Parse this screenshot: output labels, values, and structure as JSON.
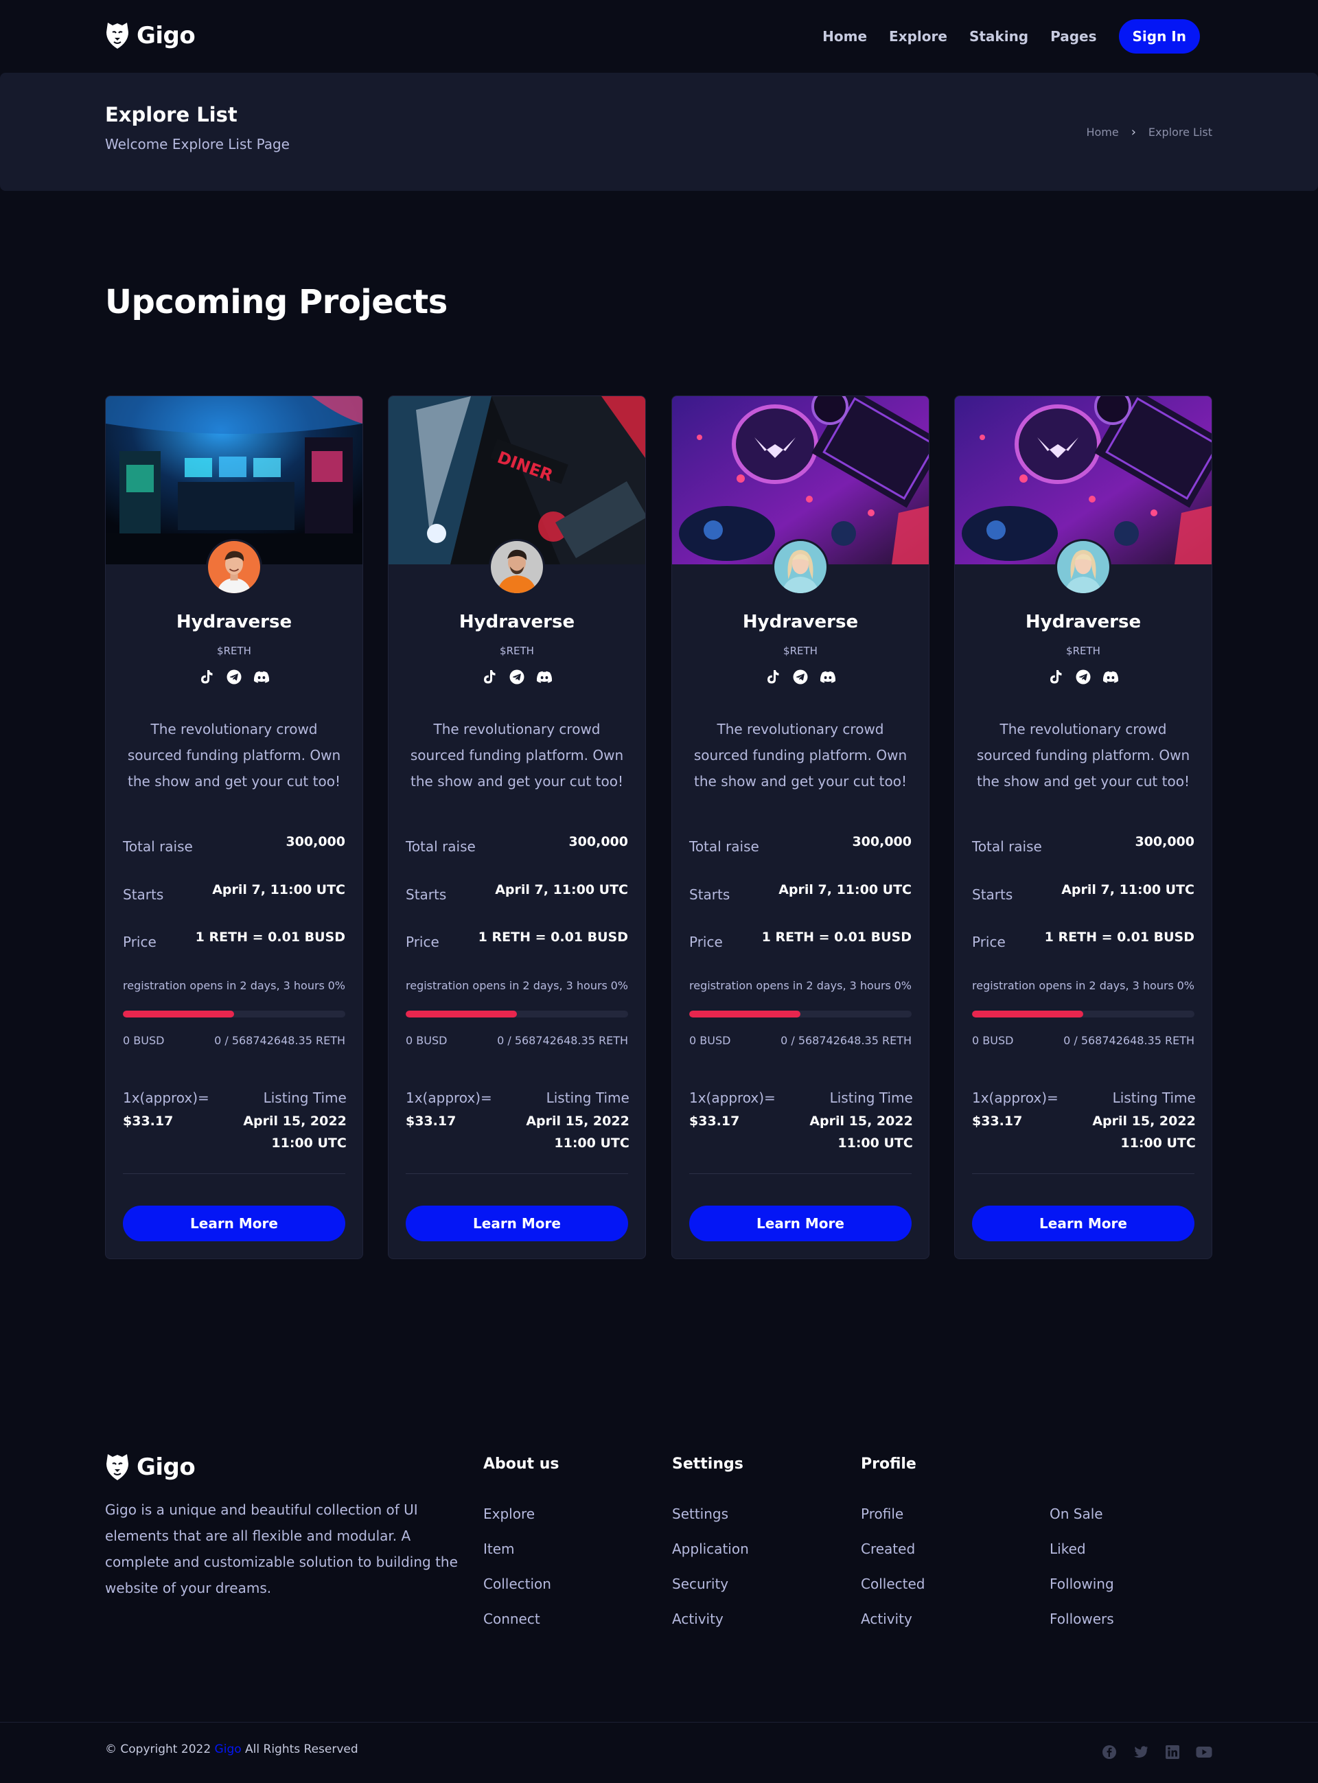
{
  "header": {
    "logo_text": "Gigo",
    "nav": [
      "Home",
      "Explore",
      "Staking",
      "Pages"
    ],
    "signin_label": "Sign In"
  },
  "banner": {
    "title": "Explore List",
    "subtitle": "Welcome Explore List Page",
    "breadcrumb": [
      "Home",
      "Explore List"
    ]
  },
  "section_title": "Upcoming Projects",
  "cards": [
    {
      "name": "Hydraverse",
      "symbol": "$RETH",
      "description": "The revolutionary crowd sourced funding platform. Own the show and get your cut too!",
      "total_raise_label": "Total raise",
      "total_raise": "300,000",
      "starts_label": "Starts",
      "starts": "April 7, 11:00 UTC",
      "price_label": "Price",
      "price": "1 RETH = 0.01 BUSD",
      "registration_text": "registration opens in 2 days, 3 hours",
      "registration_pct": "0%",
      "progress": 0.5,
      "raised_busd": "0 BUSD",
      "raised_reth": "0 / 568742648.35 RETH",
      "approx_label": "1x(approx)=",
      "approx_value": "$33.17",
      "listing_label": "Listing Time",
      "listing_value": "April 15, 2022 11:00 UTC",
      "button_label": "Learn More",
      "image_theme": "arcade",
      "avatar_theme": "orange-man"
    },
    {
      "name": "Hydraverse",
      "symbol": "$RETH",
      "description": "The revolutionary crowd sourced funding platform. Own the show and get your cut too!",
      "total_raise_label": "Total raise",
      "total_raise": "300,000",
      "starts_label": "Starts",
      "starts": "April 7, 11:00 UTC",
      "price_label": "Price",
      "price": "1 RETH = 0.01 BUSD",
      "registration_text": "registration opens in 2 days, 3 hours",
      "registration_pct": "0%",
      "progress": 0.5,
      "raised_busd": "0 BUSD",
      "raised_reth": "0 / 568742648.35 RETH",
      "approx_label": "1x(approx)=",
      "approx_value": "$33.17",
      "listing_label": "Listing Time",
      "listing_value": "April 15, 2022 11:00 UTC",
      "button_label": "Learn More",
      "image_theme": "pinball",
      "avatar_theme": "hoodie-man"
    },
    {
      "name": "Hydraverse",
      "symbol": "$RETH",
      "description": "The revolutionary crowd sourced funding platform. Own the show and get your cut too!",
      "total_raise_label": "Total raise",
      "total_raise": "300,000",
      "starts_label": "Starts",
      "starts": "April 7, 11:00 UTC",
      "price_label": "Price",
      "price": "1 RETH = 0.01 BUSD",
      "registration_text": "registration opens in 2 days, 3 hours",
      "registration_pct": "0%",
      "progress": 0.5,
      "raised_busd": "0 BUSD",
      "raised_reth": "0 / 568742648.35 RETH",
      "approx_label": "1x(approx)=",
      "approx_value": "$33.17",
      "listing_label": "Listing Time",
      "listing_value": "April 15, 2022 11:00 UTC",
      "button_label": "Learn More",
      "image_theme": "gaming-desk",
      "avatar_theme": "blonde-woman"
    },
    {
      "name": "Hydraverse",
      "symbol": "$RETH",
      "description": "The revolutionary crowd sourced funding platform. Own the show and get your cut too!",
      "total_raise_label": "Total raise",
      "total_raise": "300,000",
      "starts_label": "Starts",
      "starts": "April 7, 11:00 UTC",
      "price_label": "Price",
      "price": "1 RETH = 0.01 BUSD",
      "registration_text": "registration opens in 2 days, 3 hours",
      "registration_pct": "0%",
      "progress": 0.5,
      "raised_busd": "0 BUSD",
      "raised_reth": "0 / 568742648.35 RETH",
      "approx_label": "1x(approx)=",
      "approx_value": "$33.17",
      "listing_label": "Listing Time",
      "listing_value": "April 15, 2022 11:00 UTC",
      "button_label": "Learn More",
      "image_theme": "gaming-desk",
      "avatar_theme": "blonde-woman"
    }
  ],
  "footer": {
    "logo_text": "Gigo",
    "description": "Gigo is a unique and beautiful collection of UI elements that are all flexible and modular. A complete and customizable solution to building the website of your dreams.",
    "columns": [
      {
        "heading": "About us",
        "links": [
          "Explore",
          "Item",
          "Collection",
          "Connect"
        ]
      },
      {
        "heading": "Settings",
        "links": [
          "Settings",
          "Application",
          "Security",
          "Activity"
        ]
      },
      {
        "heading": "Profile",
        "links": [
          "Profile",
          "Created",
          "Collected",
          "Activity"
        ]
      },
      {
        "heading": "",
        "links": [
          "On Sale",
          "Liked",
          "Following",
          "Followers"
        ]
      }
    ],
    "copyright_prefix": "© Copyright 2022",
    "copyright_brand": "Gigo",
    "copyright_suffix": "All Rights Reserved",
    "social_icons": [
      "facebook-icon",
      "twitter-icon",
      "linkedin-icon",
      "youtube-icon"
    ]
  },
  "colors": {
    "background": "#0a0c17",
    "panel": "#161a2c",
    "accent": "#0416f5",
    "progress": "#e8264e",
    "muted_text": "#b6badf"
  }
}
